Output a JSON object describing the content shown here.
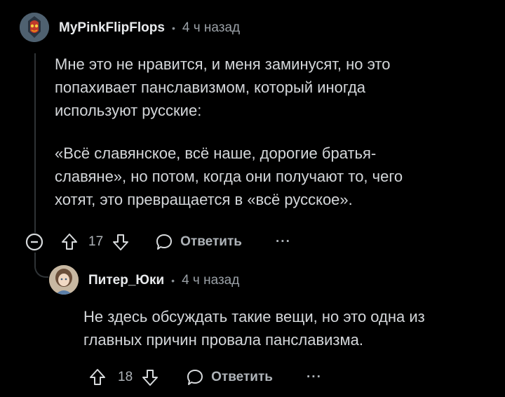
{
  "comment": {
    "author": "MyPinkFlipFlops",
    "separator": "•",
    "time": "4 ч назад",
    "paragraphs": [
      "Мне это не нравится, и меня заминусят, но это\nпопахивает панславизмом, который иногда\nиспользуют русские:",
      "«Всё славянское, всё наше, дорогие братья-\nславяне», но потом, когда они получают то, чего\nхотят, это превращается в «всё русское»."
    ],
    "score": "17",
    "reply_label": "Ответить",
    "more_label": "···"
  },
  "reply": {
    "author": "Питер_Юки",
    "separator": "•",
    "time": "4 ч назад",
    "text": "Не здесь обсуждать такие вещи, но это одна из\nглавных причин провала панславизма.",
    "score": "18",
    "reply_label": "Ответить",
    "more_label": "···"
  },
  "icons": {
    "collapse": "collapse-minus-icon",
    "upvote": "arrow-up-icon",
    "downvote": "arrow-down-icon",
    "reply": "speech-bubble-icon"
  },
  "colors": {
    "background": "#000000",
    "text": "#d7dadc",
    "muted": "#9aa0a6",
    "thread_line": "#2f3336"
  }
}
